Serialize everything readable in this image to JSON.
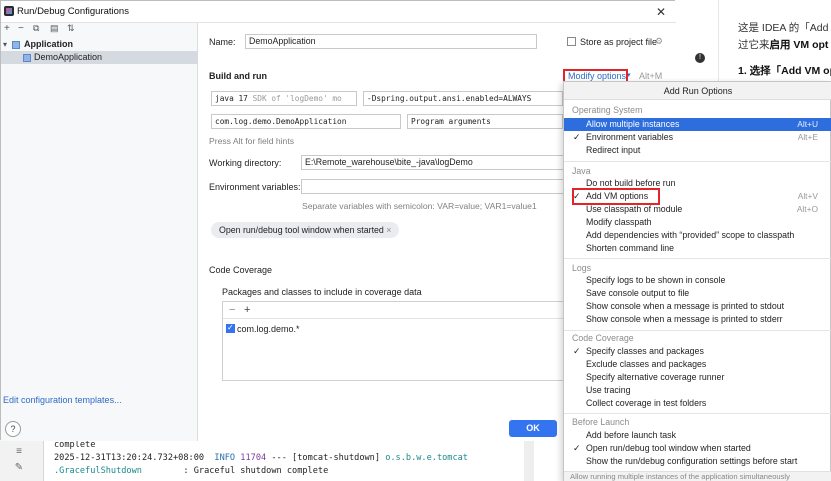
{
  "dialog": {
    "title": "Run/Debug Configurations",
    "toolbar_icons": [
      "add-icon",
      "remove-icon",
      "copy-icon",
      "save-icon",
      "sort-icon"
    ],
    "tree": {
      "group_label": "Application",
      "child_label": "DemoApplication"
    },
    "edit_templates_link": "Edit configuration templates...",
    "help_label": "?",
    "ok_label": "OK"
  },
  "form": {
    "name_label": "Name:",
    "name_value": "DemoApplication",
    "store_project_label": "Store as project file",
    "build_run_label": "Build and run",
    "modify_options_label": "Modify options",
    "modify_shortcut": "Alt+M",
    "jdk_value": "java 17",
    "jdk_hint": "SDK of 'logDemo' mo",
    "vm_options_value": "-Dspring.output.ansi.enabled=ALWAYS",
    "main_class_value": "com.log.demo.DemoApplication",
    "program_args_placeholder": "Program arguments",
    "field_hints_text": "Press Alt for field hints",
    "workdir_label": "Working directory:",
    "workdir_value": "E:\\Remote_warehouse\\bite_-java\\logDemo",
    "env_label": "Environment variables:",
    "env_hint": "Separate variables with semicolon: VAR=value; VAR1=value1",
    "chip_label": "Open run/debug tool window when started",
    "coverage_title": "Code Coverage",
    "coverage_packages_label": "Packages and classes to include in coverage data",
    "coverage_entry": "com.log.demo.*"
  },
  "popup": {
    "title": "Add Run Options",
    "groups": [
      {
        "label": "Operating System",
        "items": [
          {
            "label": "Allow multiple instances",
            "shortcut": "Alt+U",
            "checked": false,
            "selected": true
          },
          {
            "label": "Environment variables",
            "shortcut": "Alt+E",
            "checked": true,
            "selected": false
          },
          {
            "label": "Redirect input",
            "shortcut": "",
            "checked": false,
            "selected": false
          }
        ]
      },
      {
        "label": "Java",
        "items": [
          {
            "label": "Do not build before run",
            "shortcut": "",
            "checked": false,
            "selected": false
          },
          {
            "label": "Add VM options",
            "shortcut": "Alt+V",
            "checked": true,
            "selected": false
          },
          {
            "label": "Use classpath of module",
            "shortcut": "Alt+O",
            "checked": false,
            "selected": false
          },
          {
            "label": "Modify classpath",
            "shortcut": "",
            "checked": false,
            "selected": false
          },
          {
            "label": "Add dependencies with “provided” scope to classpath",
            "shortcut": "",
            "checked": false,
            "selected": false
          },
          {
            "label": "Shorten command line",
            "shortcut": "",
            "checked": false,
            "selected": false
          }
        ]
      },
      {
        "label": "Logs",
        "items": [
          {
            "label": "Specify logs to be shown in console",
            "shortcut": "",
            "checked": false,
            "selected": false
          },
          {
            "label": "Save console output to file",
            "shortcut": "",
            "checked": false,
            "selected": false
          },
          {
            "label": "Show console when a message is printed to stdout",
            "shortcut": "",
            "checked": false,
            "selected": false
          },
          {
            "label": "Show console when a message is printed to stderr",
            "shortcut": "",
            "checked": false,
            "selected": false
          }
        ]
      },
      {
        "label": "Code Coverage",
        "items": [
          {
            "label": "Specify classes and packages",
            "shortcut": "",
            "checked": true,
            "selected": false
          },
          {
            "label": "Exclude classes and packages",
            "shortcut": "",
            "checked": false,
            "selected": false
          },
          {
            "label": "Specify alternative coverage runner",
            "shortcut": "",
            "checked": false,
            "selected": false
          },
          {
            "label": "Use tracing",
            "shortcut": "",
            "checked": false,
            "selected": false
          },
          {
            "label": "Collect coverage in test folders",
            "shortcut": "",
            "checked": false,
            "selected": false
          }
        ]
      },
      {
        "label": "Before Launch",
        "items": [
          {
            "label": "Add before launch task",
            "shortcut": "",
            "checked": false,
            "selected": false
          },
          {
            "label": "Open run/debug tool window when started",
            "shortcut": "",
            "checked": true,
            "selected": false
          },
          {
            "label": "Show the run/debug configuration settings before start",
            "shortcut": "",
            "checked": false,
            "selected": false
          }
        ]
      }
    ],
    "footer": "Allow running multiple instances of the application simultaneously"
  },
  "console": {
    "line1": "complete",
    "line2_time": "2025-12-31T13:20:24.732+08:00",
    "line2_level": "INFO",
    "line2_pid": "11704",
    "line2_thread": "--- [tomcat-shutdown]",
    "line2_logger": "o.s.b.w.e.tomcat",
    "line3_logger": ".GracefulShutdown",
    "line3_msg": ": Graceful shutdown complete"
  },
  "doc": {
    "line1": "这是 IDEA 的「Add",
    "line2_pre": "过它来",
    "line2_bold": "启用 VM opt",
    "heading": "1. 选择「Add VM op",
    "badge": "!"
  },
  "colors": {
    "accent": "#3574f0",
    "selection": "#2d6ddd",
    "highlight_box": "#e0262a",
    "link": "#2e6bc4"
  }
}
